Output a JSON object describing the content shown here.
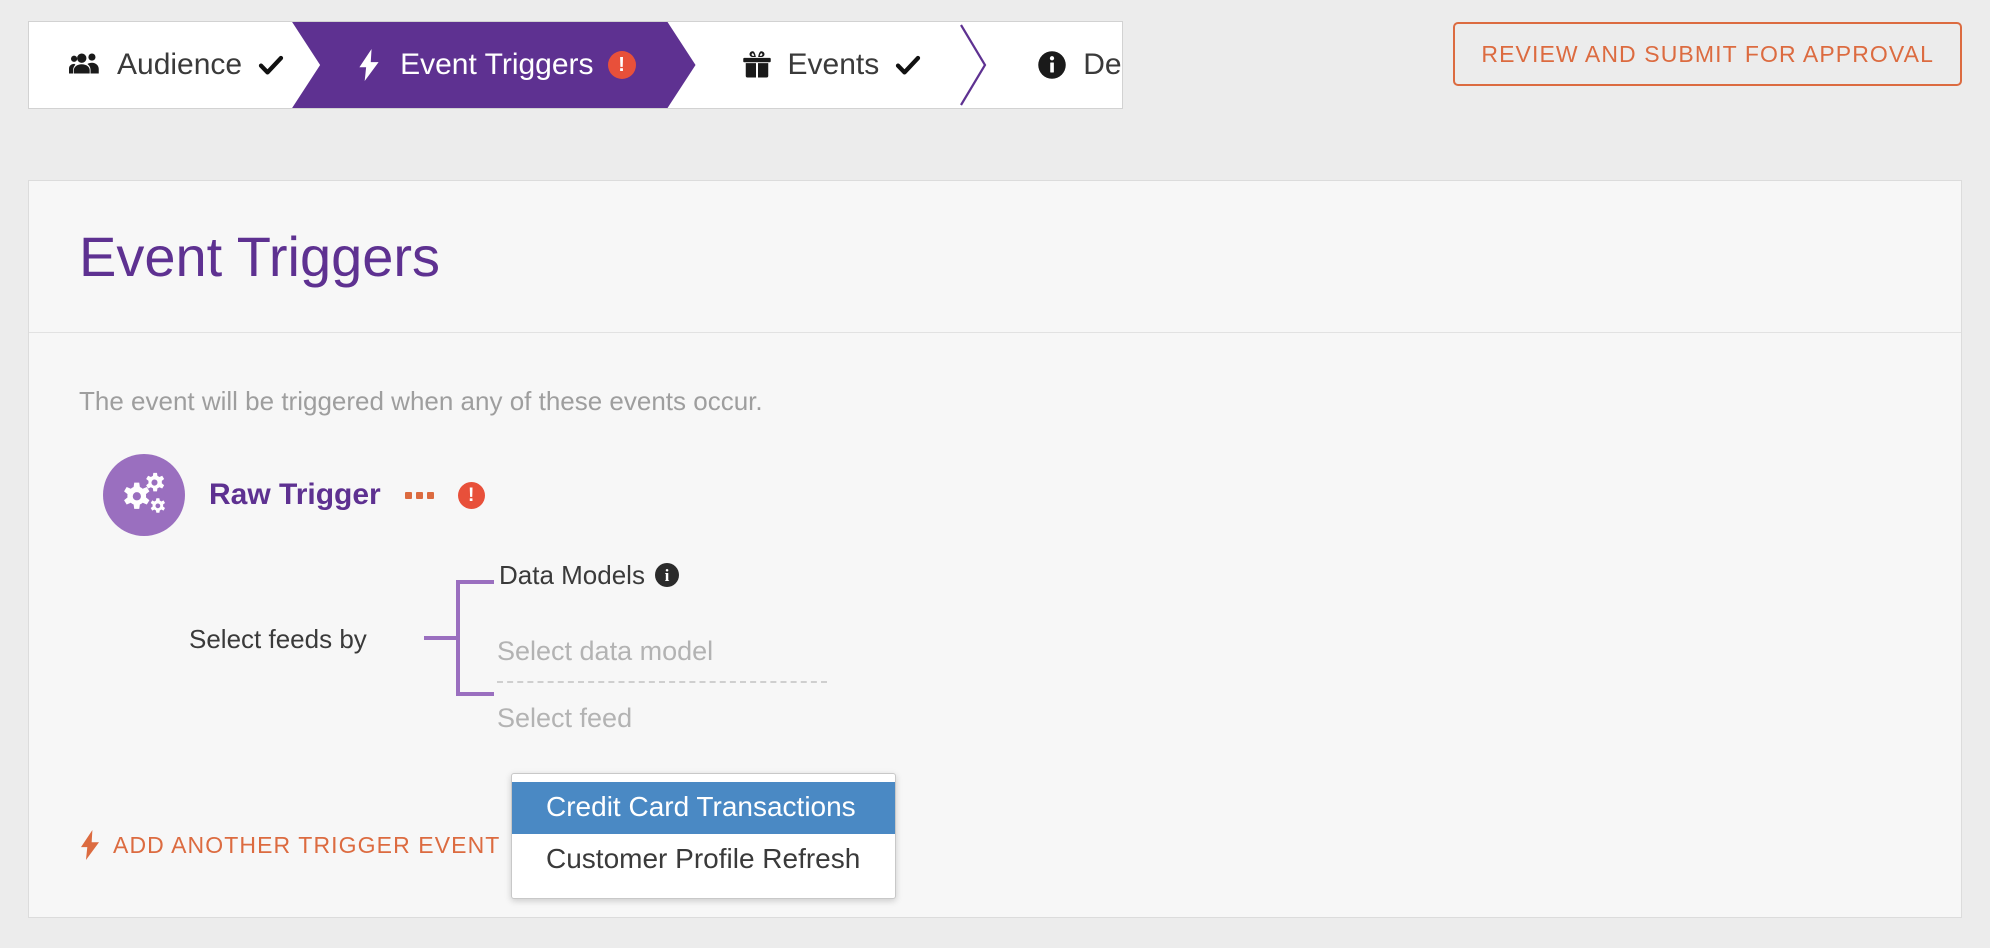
{
  "wizard": {
    "steps": [
      {
        "label": "Audience",
        "icon": "users-icon",
        "state": "complete",
        "badge": "check"
      },
      {
        "label": "Event Triggers",
        "icon": "bolt-icon",
        "state": "active",
        "badge": "error"
      },
      {
        "label": "Events",
        "icon": "gift-icon",
        "state": "complete",
        "badge": "check"
      },
      {
        "label": "Details",
        "icon": "info-icon",
        "state": "complete",
        "badge": "check"
      }
    ],
    "error_mark": "!"
  },
  "header": {
    "submit_label": "REVIEW AND SUBMIT FOR APPROVAL"
  },
  "card": {
    "title": "Event Triggers",
    "description": "The event will be triggered when any of these events occur."
  },
  "trigger": {
    "name": "Raw Trigger",
    "avatar_icon": "gears-icon",
    "menu_icon": "ellipsis-icon",
    "error_icon": "error-exclamation-icon",
    "error_mark": "!"
  },
  "feeds": {
    "select_by_label": "Select feeds by",
    "data_models_label": "Data Models",
    "info_icon": "info-icon",
    "info_mark": "i",
    "data_model_placeholder": "Select data model",
    "feed_placeholder": "Select feed"
  },
  "dropdown": {
    "options": [
      {
        "label": "Credit Card Transactions",
        "selected": true
      },
      {
        "label": "Customer Profile Refresh",
        "selected": false
      }
    ]
  },
  "footer": {
    "add_trigger_label": "ADD ANOTHER TRIGGER EVENT",
    "bolt_icon": "bolt-icon"
  },
  "colors": {
    "purple": "#5E3191",
    "purple_light": "#9a6fbf",
    "orange": "#dc6b40",
    "error_red": "#e8503a",
    "highlight_blue": "#4a89c4"
  }
}
